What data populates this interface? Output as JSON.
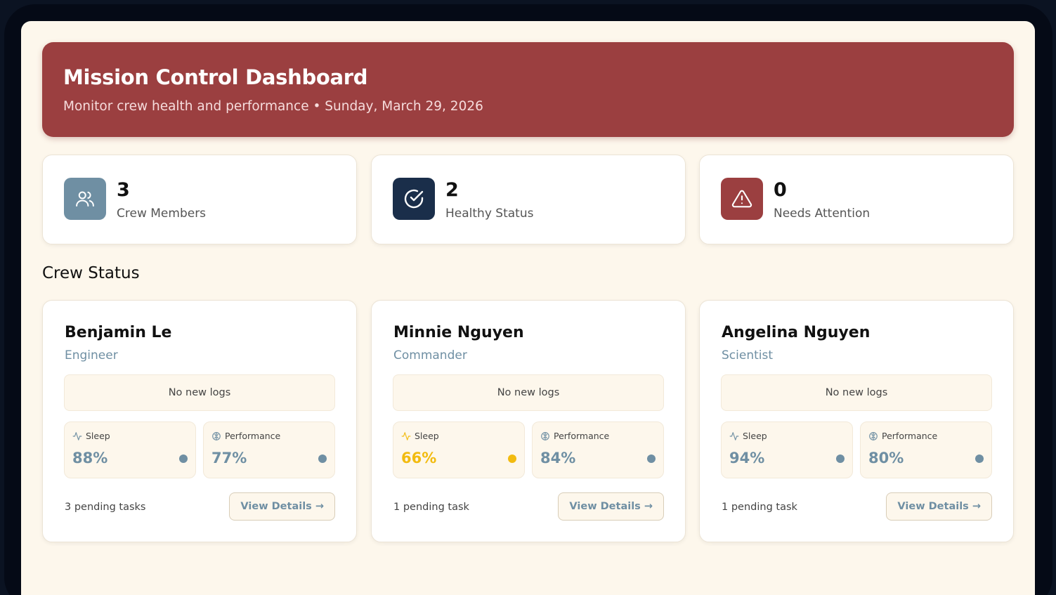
{
  "header": {
    "title": "Mission Control Dashboard",
    "subtitle": "Monitor crew health and performance • Sunday, March 29, 2026"
  },
  "stats": [
    {
      "value": "3",
      "label": "Crew Members",
      "icon": "users-icon",
      "color": "#6f8fa3"
    },
    {
      "value": "2",
      "label": "Healthy Status",
      "icon": "check-circle-icon",
      "color": "#1a2e4a"
    },
    {
      "value": "0",
      "label": "Needs Attention",
      "icon": "alert-triangle-icon",
      "color": "#9b3f40"
    }
  ],
  "section_title": "Crew Status",
  "crew": [
    {
      "name": "Benjamin Le",
      "role": "Engineer",
      "logs": "No new logs",
      "sleep": {
        "label": "Sleep",
        "value": "88%",
        "color": "#6f8fa3"
      },
      "performance": {
        "label": "Performance",
        "value": "77%",
        "color": "#6f8fa3"
      },
      "tasks": "3 pending tasks",
      "button": "View Details →"
    },
    {
      "name": "Minnie Nguyen",
      "role": "Commander",
      "logs": "No new logs",
      "sleep": {
        "label": "Sleep",
        "value": "66%",
        "color": "#f2bb10"
      },
      "performance": {
        "label": "Performance",
        "value": "84%",
        "color": "#6f8fa3"
      },
      "tasks": "1 pending task",
      "button": "View Details →"
    },
    {
      "name": "Angelina Nguyen",
      "role": "Scientist",
      "logs": "No new logs",
      "sleep": {
        "label": "Sleep",
        "value": "94%",
        "color": "#6f8fa3"
      },
      "performance": {
        "label": "Performance",
        "value": "80%",
        "color": "#6f8fa3"
      },
      "tasks": "1 pending task",
      "button": "View Details →"
    }
  ]
}
